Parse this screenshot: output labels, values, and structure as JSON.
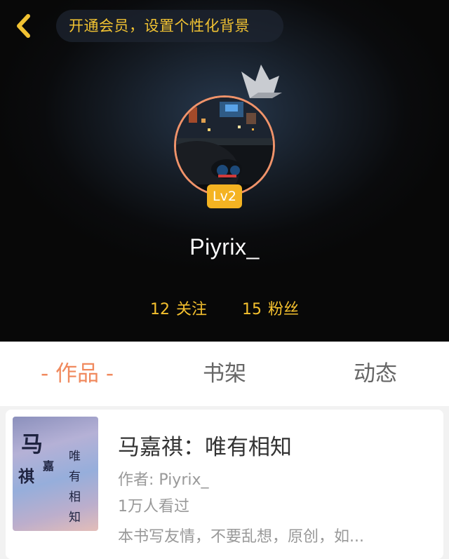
{
  "header": {
    "vip_banner": "开通会员，设置个性化背景",
    "level": "Lv2",
    "username": "Piyrix_",
    "stats": {
      "following_count": "12",
      "following_label": "关注",
      "fans_count": "15",
      "fans_label": "粉丝"
    }
  },
  "tabs": [
    {
      "label": "- 作品 -",
      "active": true
    },
    {
      "label": "书架",
      "active": false
    },
    {
      "label": "动态",
      "active": false
    }
  ],
  "books": [
    {
      "title": "马嘉祺：唯有相知",
      "author": "作者: Piyrix_",
      "views": "1万人看过",
      "description": "本书写友情，不要乱想，原创，如...",
      "cover_text": {
        "title_chars": [
          "马",
          "嘉",
          "祺"
        ],
        "subtitle_chars": [
          "唯",
          "有",
          "相",
          "知"
        ]
      }
    }
  ],
  "colors": {
    "accent_gold": "#f4c02e",
    "tab_active": "#f08a5e",
    "level_badge": "#f4b322",
    "avatar_ring": "#f0936a"
  },
  "icons": {
    "back": "chevron-left-icon",
    "crown": "crown-icon"
  }
}
